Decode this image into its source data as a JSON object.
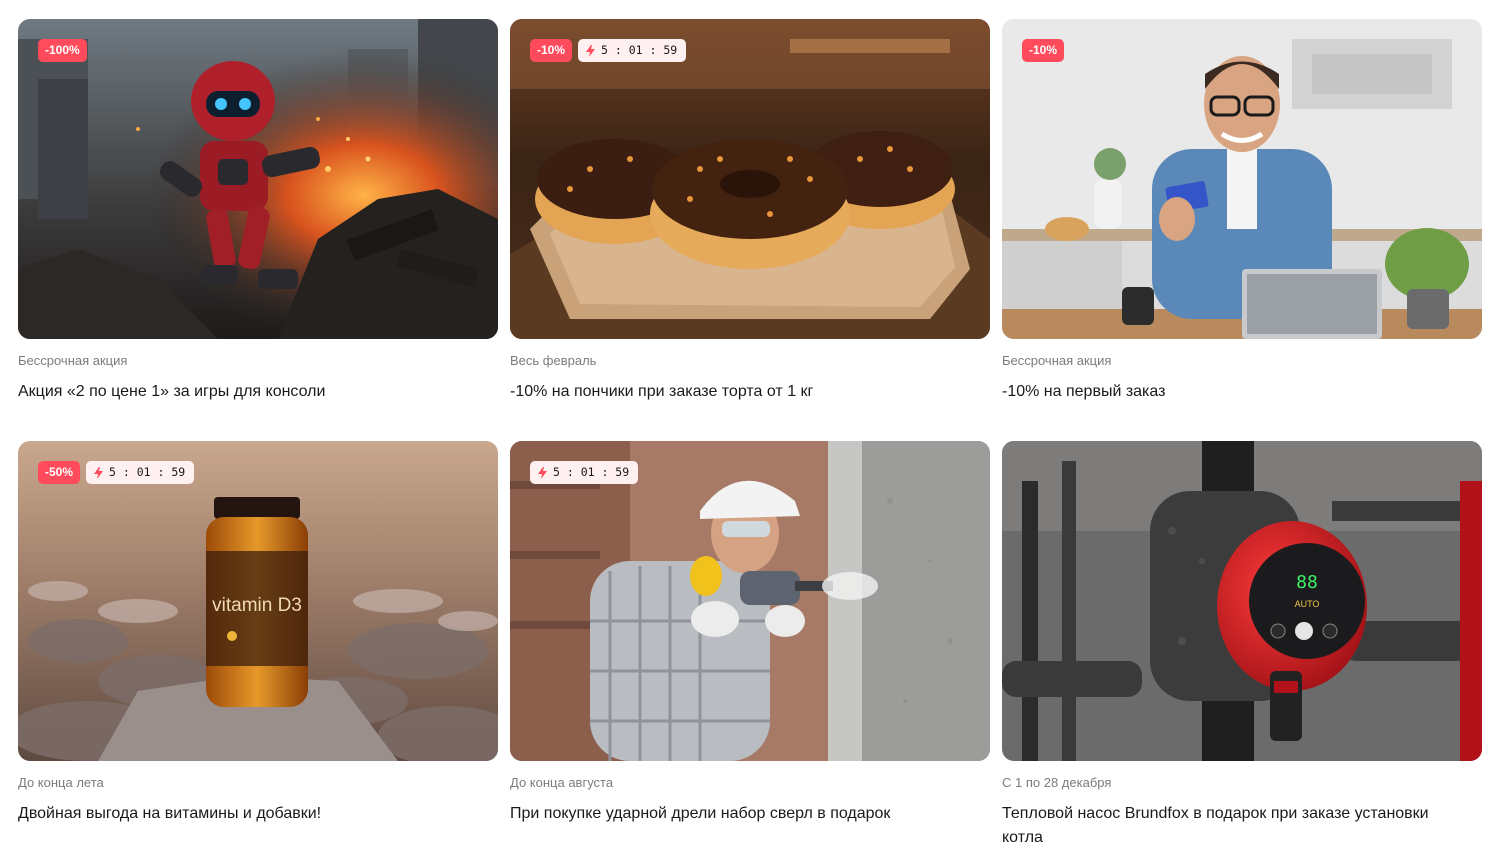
{
  "promotions": [
    {
      "discount": "-100%",
      "timer": "",
      "period": "Бессрочная акция",
      "title": "Акция «2 по цене 1» за игры для консоли",
      "image": "robot-game-scene"
    },
    {
      "discount": "-10%",
      "timer": "5 : 01 : 59",
      "period": "Весь февраль",
      "title": "-10% на пончики при заказе торта от 1 кг",
      "image": "chocolate-donuts"
    },
    {
      "discount": "-10%",
      "timer": "",
      "period": "Бессрочная акция",
      "title": "-10% на первый заказ",
      "image": "man-with-card-at-laptop"
    },
    {
      "discount": "-50%",
      "timer": "5 : 01 : 59",
      "period": "До конца лета",
      "title": "Двойная выгода на витамины и добавки!",
      "image": "vitamin-jar-on-rocks",
      "image_text": "vitamin D3"
    },
    {
      "discount": "",
      "timer": "5 : 01 : 59",
      "period": "До конца августа",
      "title": "При покупке ударной дрели набор сверл в подарок",
      "image": "worker-with-drill"
    },
    {
      "discount": "",
      "timer": "",
      "period": "С 1 по 28 декабря",
      "title": "Тепловой насос Brundfox в подарок при заказе установки котла",
      "image": "circulation-pump",
      "image_text": "AUTO"
    }
  ],
  "colors": {
    "discount_badge": "#ff4b5c",
    "timer_badge": "#fff0f1",
    "period_text": "#7c7c7c"
  },
  "icons": {
    "timer": "lightning-icon"
  }
}
